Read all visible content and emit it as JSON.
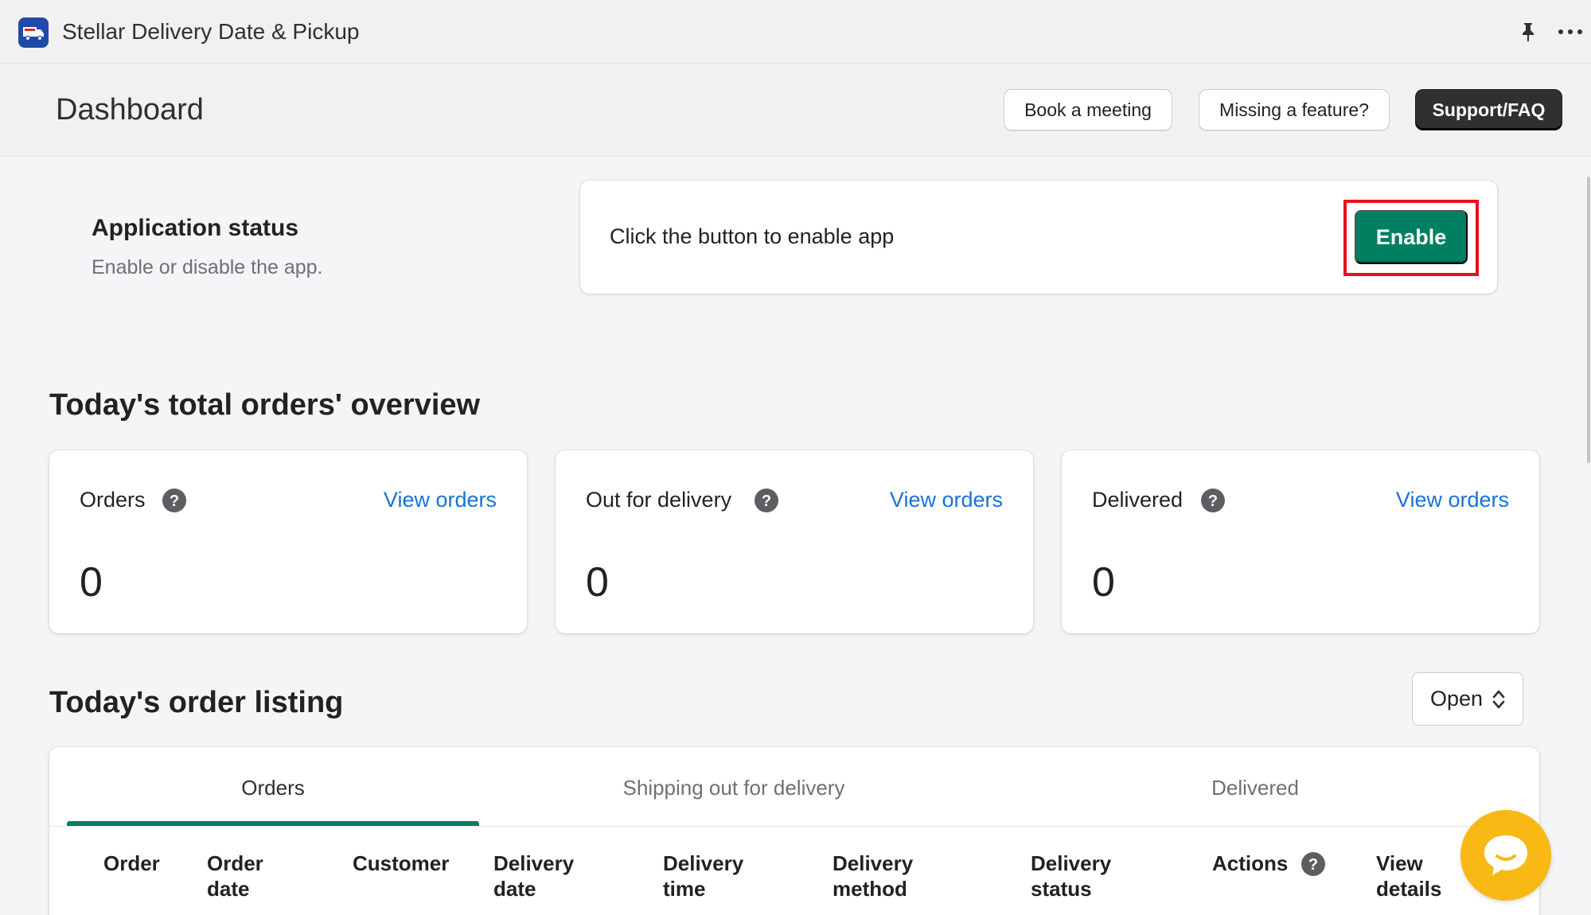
{
  "app": {
    "title": "Stellar Delivery Date & Pickup"
  },
  "header": {
    "page_title": "Dashboard",
    "buttons": {
      "book": "Book a meeting",
      "missing": "Missing a feature?",
      "support": "Support/FAQ"
    }
  },
  "status": {
    "heading": "Application status",
    "subtext": "Enable or disable the app.",
    "prompt": "Click the button to enable app",
    "enable_label": "Enable"
  },
  "overview": {
    "title": "Today's total orders' overview",
    "cards": [
      {
        "label": "Orders",
        "link": "View orders",
        "value": "0"
      },
      {
        "label": "Out for delivery",
        "link": "View orders",
        "value": "0"
      },
      {
        "label": "Delivered",
        "link": "View orders",
        "value": "0"
      }
    ]
  },
  "listing": {
    "title": "Today's order listing",
    "filter_value": "Open",
    "tabs": [
      "Orders",
      "Shipping out for delivery",
      "Delivered"
    ],
    "columns": [
      [
        "Order"
      ],
      [
        "Order",
        "date"
      ],
      [
        "Customer"
      ],
      [
        "Delivery",
        "date"
      ],
      [
        "Delivery",
        "time"
      ],
      [
        "Delivery",
        "method"
      ],
      [
        "Delivery",
        "status"
      ],
      [
        "Actions"
      ],
      [
        "View",
        "details"
      ]
    ]
  },
  "colors": {
    "primary_green": "#008060",
    "link_blue": "#1773d6",
    "highlight_red": "#e5101a",
    "chat_yellow": "#f9b915"
  },
  "icons": {
    "app_logo": "delivery-truck-icon",
    "pin": "pin-icon",
    "more": "more-horizontal-icon",
    "help": "question-circle-icon",
    "select": "select-caret-icon",
    "chat": "chat-bubble-icon"
  }
}
